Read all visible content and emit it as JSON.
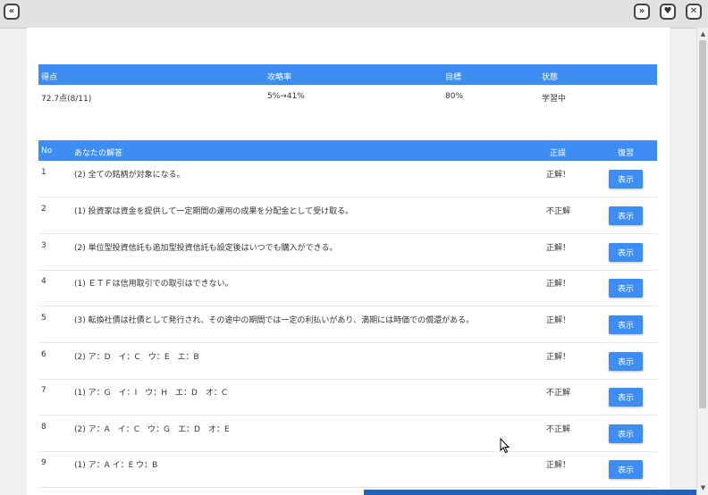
{
  "icons": {
    "collapse": "chevron-double-up-icon",
    "forward": "chevron-double-right-icon",
    "favorite": "heart-icon",
    "close": "close-icon"
  },
  "colors": {
    "accent": "#3d8df5"
  },
  "summary": {
    "headers": {
      "score": "得点",
      "progress": "攻略率",
      "target": "目標",
      "status": "状態"
    },
    "values": {
      "score": "72.7点(8/11)",
      "progress": "5%→41%",
      "target": "80%",
      "status": "学習中"
    }
  },
  "answers": {
    "headers": {
      "no": "No",
      "answer": "あなたの解答",
      "result": "正誤",
      "review": "復習"
    },
    "button_label": "表示",
    "rows": [
      {
        "no": "1",
        "answer": "(2) 全ての銘柄が対象になる。",
        "result": "正解！"
      },
      {
        "no": "2",
        "answer": "(1) 投資家は資金を提供して一定期間の運用の成果を分配金として受け取る。",
        "result": "不正解"
      },
      {
        "no": "3",
        "answer": "(2) 単位型投資信託も追加型投資信託も設定後はいつでも購入ができる。",
        "result": "正解！"
      },
      {
        "no": "4",
        "answer": "(1) ＥＴＦは信用取引での取引はできない。",
        "result": "正解！"
      },
      {
        "no": "5",
        "answer": "(3) 転換社債は社債として発行され、その途中の期間では一定の利払いがあり、満期には時価での償還がある。",
        "result": "正解！"
      },
      {
        "no": "6",
        "answer": "(2) ア：D　イ：C　ウ：E　エ：B",
        "result": "正解！"
      },
      {
        "no": "7",
        "answer": "(1) ア：G　イ：I　ウ：H　エ：D　オ：C",
        "result": "不正解"
      },
      {
        "no": "8",
        "answer": "(2) ア：A　イ：C　ウ：G　エ：D　オ：E",
        "result": "不正解"
      },
      {
        "no": "9",
        "answer": "(1) ア：A イ：E ウ：B",
        "result": "正解！"
      }
    ]
  }
}
